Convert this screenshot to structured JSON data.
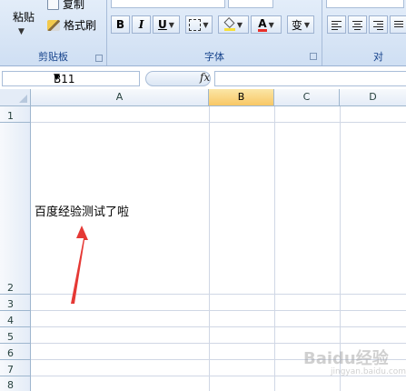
{
  "ribbon": {
    "clipboard": {
      "paste_label": "粘贴",
      "copy_label": "复制",
      "format_painter_label": "格式刷",
      "group_label": "剪贴板"
    },
    "font": {
      "bold_label": "B",
      "italic_label": "I",
      "underline_label": "U",
      "font_color_label": "A",
      "phonetic_label": "变",
      "group_label": "字体",
      "font_color": "#e8302a",
      "fill_color": "#f7e03a"
    },
    "alignment": {
      "group_label": "对"
    }
  },
  "formula_bar": {
    "name_box_value": "B11",
    "fx_label": "fx",
    "formula_value": ""
  },
  "sheet": {
    "columns": [
      "A",
      "B",
      "C",
      "D"
    ],
    "selected_column": "B",
    "rows": [
      "1",
      "2",
      "3",
      "4",
      "5",
      "6",
      "7",
      "8"
    ],
    "cell_A2": "百度经验测试了啦"
  },
  "annotation": {
    "arrow_color": "#e53935"
  },
  "watermark": {
    "text": "Baidu经验",
    "subtext": "jingyan.baidu.com"
  }
}
